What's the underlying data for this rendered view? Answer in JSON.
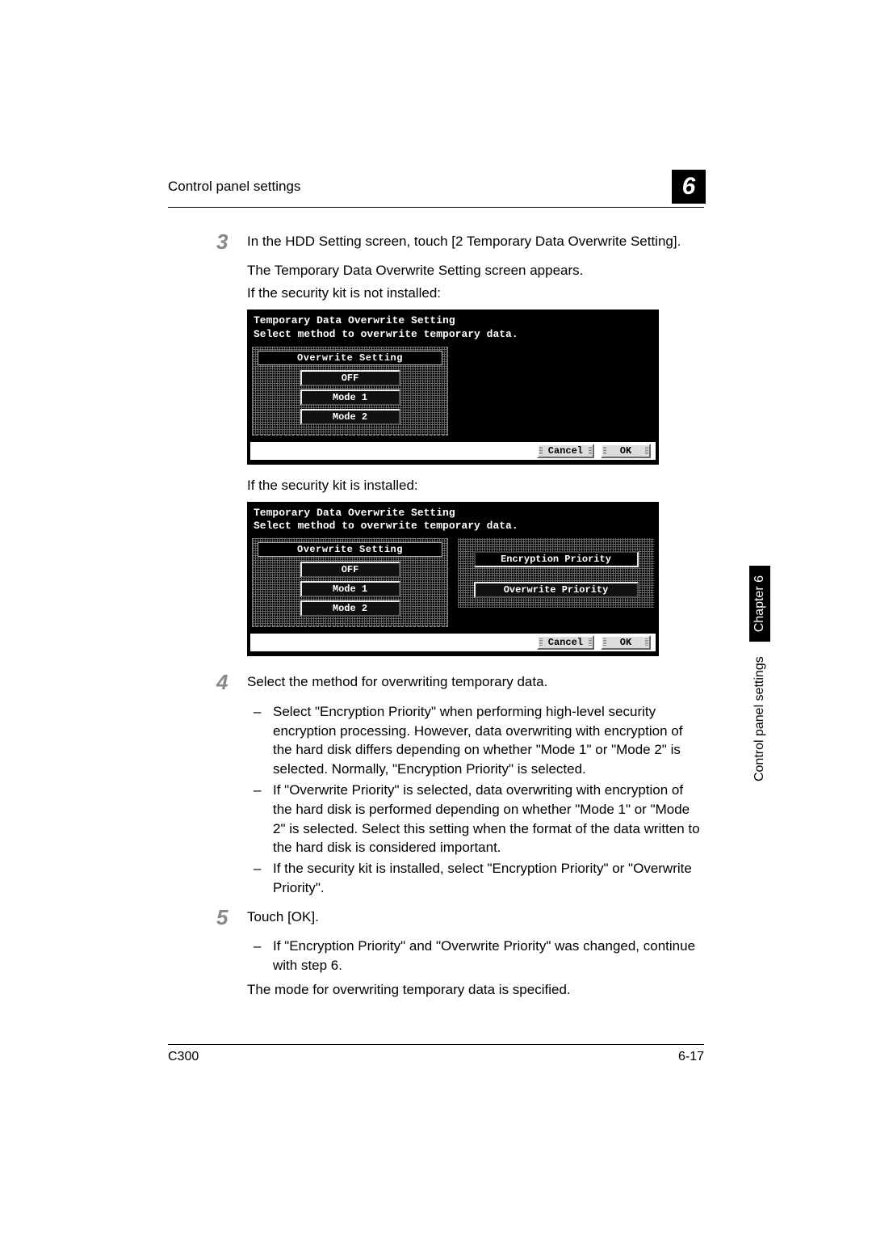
{
  "header": {
    "title": "Control panel settings",
    "chapter_num": "6"
  },
  "side": {
    "label": "Control panel settings",
    "chapter": "Chapter 6"
  },
  "steps": {
    "s3": {
      "num": "3",
      "line1": "In the HDD Setting screen, touch [2 Temporary Data Overwrite Setting].",
      "line2": "The Temporary Data Overwrite Setting screen appears.",
      "line3": "If the security kit is not installed:"
    },
    "s4": {
      "pre": "If the security kit is installed:",
      "num": "4",
      "line": "Select the method for overwriting temporary data.",
      "b1": "Select \"Encryption Priority\" when performing high-level security encryption processing. However, data overwriting with encryption of the hard disk differs depending on whether \"Mode 1\" or \"Mode 2\" is selected. Normally, \"Encryption Priority\" is selected.",
      "b2": "If \"Overwrite Priority\" is selected, data overwriting with encryption of the hard disk is performed depending on whether \"Mode 1\" or \"Mode 2\" is selected. Select this setting when the format of the data written to the hard disk is considered important.",
      "b3": "If the security kit is installed, select \"Encryption Priority\" or \"Overwrite Priority\"."
    },
    "s5": {
      "num": "5",
      "line": "Touch [OK].",
      "b1": "If \"Encryption Priority\" and \"Overwrite Priority\" was changed, continue with step 6.",
      "line2": "The mode for overwriting temporary data is specified."
    }
  },
  "panel1": {
    "title1": "Temporary Data Overwrite Setting",
    "title2": "Select method to overwrite temporary data.",
    "group_title": "Overwrite Setting",
    "off": "OFF",
    "m1": "Mode 1",
    "m2": "Mode 2",
    "cancel": "Cancel",
    "ok": "OK"
  },
  "panel2": {
    "title1": "Temporary Data Overwrite Setting",
    "title2": "Select method to overwrite temporary data.",
    "group_title": "Overwrite Setting",
    "off": "OFF",
    "m1": "Mode 1",
    "m2": "Mode 2",
    "enc": "Encryption Priority",
    "ovw": "Overwrite Priority",
    "cancel": "Cancel",
    "ok": "OK"
  },
  "footer": {
    "left": "C300",
    "right": "6-17"
  }
}
